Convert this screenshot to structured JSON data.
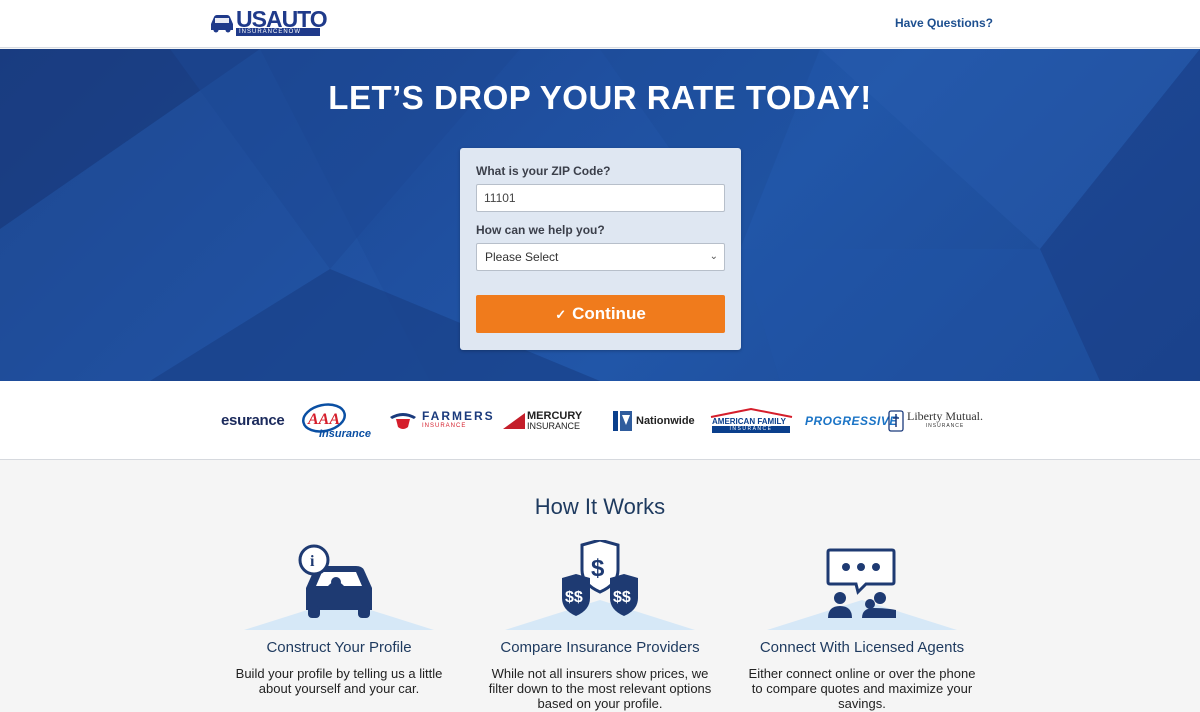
{
  "header": {
    "logo": {
      "top": "USAUTO",
      "top_us": "US",
      "top_auto": "AUTO",
      "sub": "INSURANCENOW"
    },
    "have_questions": "Have Questions?"
  },
  "hero": {
    "title": "LET’S DROP YOUR RATE TODAY!",
    "form": {
      "zip_label": "What is your ZIP Code?",
      "zip_value": "11101",
      "help_label": "How can we help you?",
      "help_selected": "Please Select",
      "continue_label": "Continue"
    }
  },
  "insurers": [
    {
      "name": "esurance"
    },
    {
      "name": "AAA",
      "sub": "Insurance"
    },
    {
      "name": "FARMERS",
      "sub": "INSURANCE"
    },
    {
      "name": "MERCURY",
      "sub": "INSURANCE"
    },
    {
      "name": "Nationwide"
    },
    {
      "name": "AMERICAN FAMILY",
      "sub": "INSURANCE"
    },
    {
      "name": "PROGRESSIVE"
    },
    {
      "name": "Liberty Mutual.",
      "sub": "INSURANCE"
    }
  ],
  "how_it_works": {
    "title": "How It Works",
    "steps": [
      {
        "title": "Construct Your Profile",
        "desc": "Build your profile by telling us a little about yourself and your car."
      },
      {
        "title": "Compare Insurance Providers",
        "desc": "While not all insurers show prices, we filter down to the most relevant options based on your profile."
      },
      {
        "title": "Connect With Licensed Agents",
        "desc": "Either connect online or over the phone to compare quotes and maximize your savings."
      }
    ]
  },
  "colors": {
    "accent": "#f07b1c",
    "hero": "#1f4f9f",
    "navy": "#1f3a8a",
    "text_dark": "#1e3a5f"
  },
  "icons": [
    "car-icon",
    "chevron-down-icon",
    "check-icon",
    "info-car-icon",
    "dollar-shields-icon",
    "chat-people-icon"
  ]
}
